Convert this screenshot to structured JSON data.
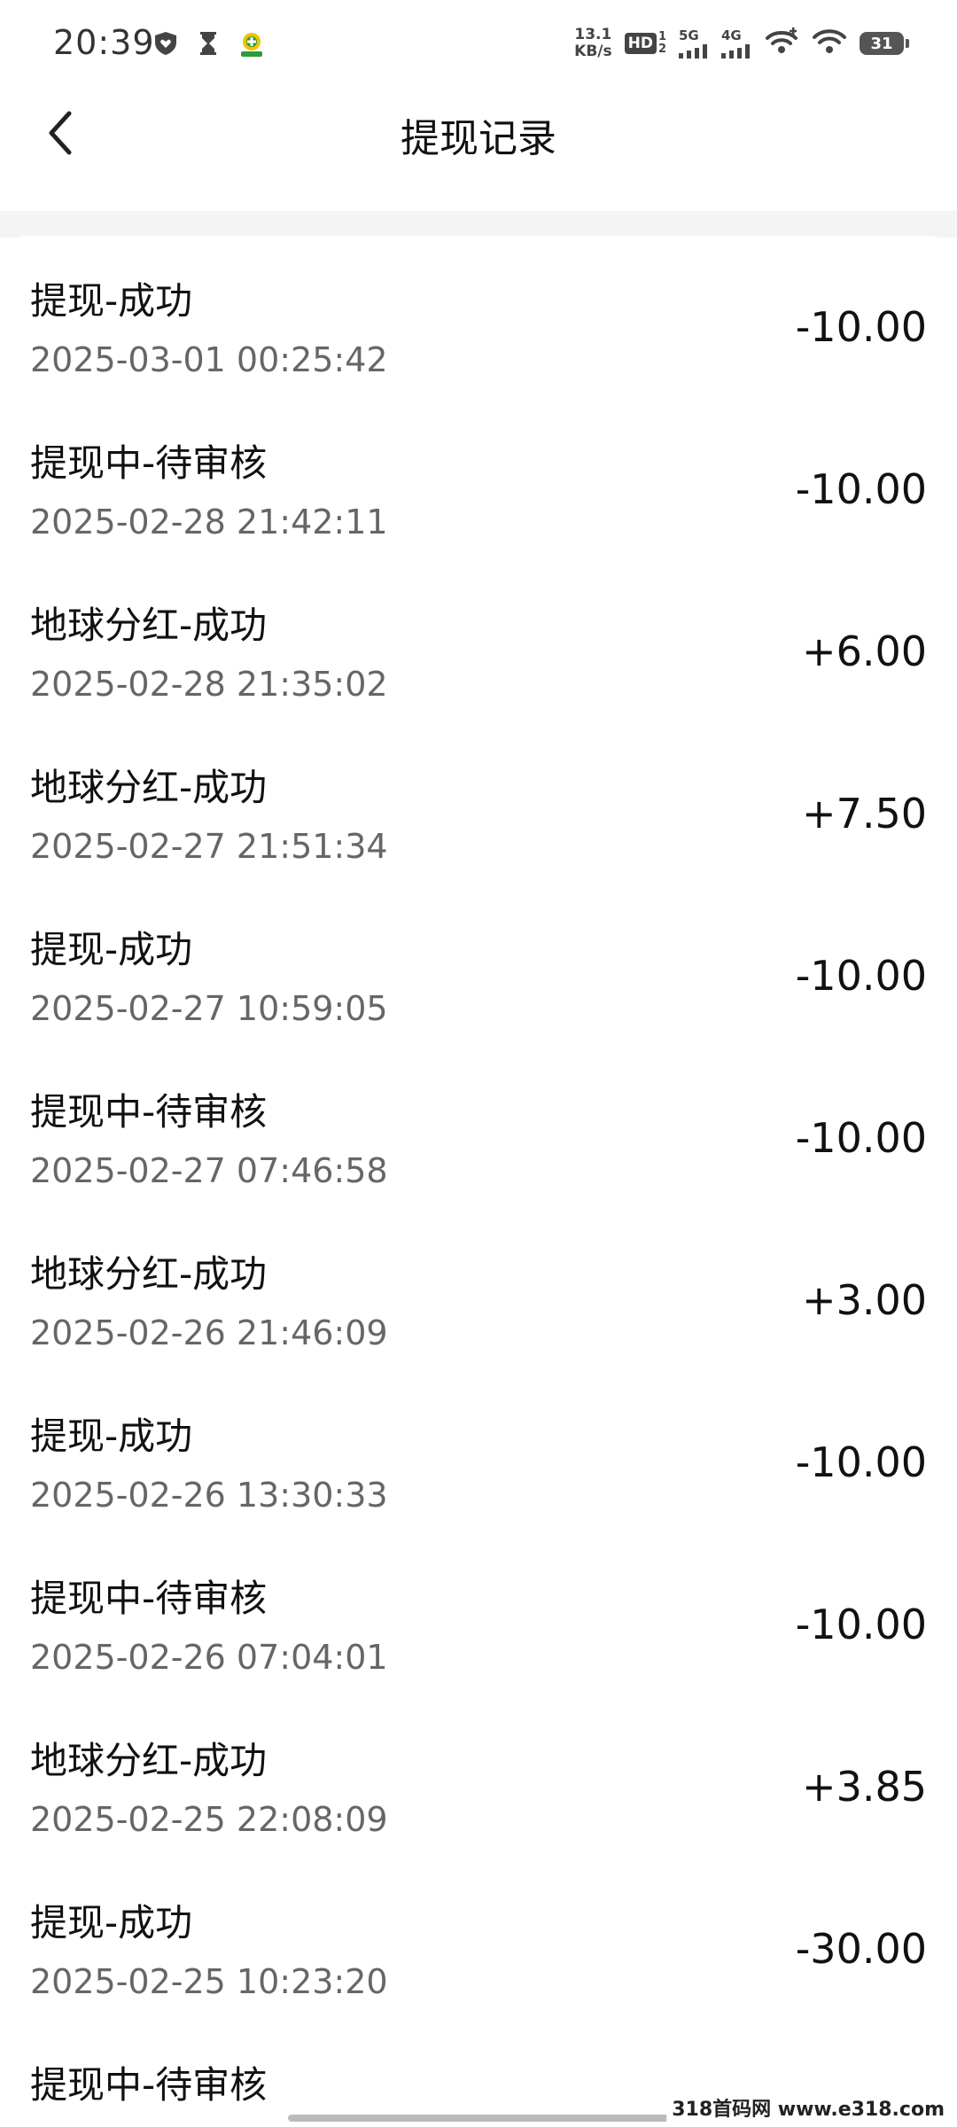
{
  "status_bar": {
    "time": "20:39",
    "net_speed_value": "13.1",
    "net_speed_unit": "KB/s",
    "hd_label": "HD",
    "hd_sub_top": "1",
    "hd_sub_bottom": "2",
    "signal1_gen": "5G",
    "signal2_gen": "4G",
    "battery": "31"
  },
  "header": {
    "title": "提现记录"
  },
  "records": [
    {
      "title": "提现-成功",
      "time": "2025-03-01 00:25:42",
      "amount": "-10.00"
    },
    {
      "title": "提现中-待审核",
      "time": "2025-02-28 21:42:11",
      "amount": "-10.00"
    },
    {
      "title": "地球分红-成功",
      "time": "2025-02-28 21:35:02",
      "amount": "+6.00"
    },
    {
      "title": "地球分红-成功",
      "time": "2025-02-27 21:51:34",
      "amount": "+7.50"
    },
    {
      "title": "提现-成功",
      "time": "2025-02-27 10:59:05",
      "amount": "-10.00"
    },
    {
      "title": "提现中-待审核",
      "time": "2025-02-27 07:46:58",
      "amount": "-10.00"
    },
    {
      "title": "地球分红-成功",
      "time": "2025-02-26 21:46:09",
      "amount": "+3.00"
    },
    {
      "title": "提现-成功",
      "time": "2025-02-26 13:30:33",
      "amount": "-10.00"
    },
    {
      "title": "提现中-待审核",
      "time": "2025-02-26 07:04:01",
      "amount": "-10.00"
    },
    {
      "title": "地球分红-成功",
      "time": "2025-02-25 22:08:09",
      "amount": "+3.85"
    },
    {
      "title": "提现-成功",
      "time": "2025-02-25 10:23:20",
      "amount": "-30.00"
    },
    {
      "title": "提现中-待审核",
      "time": "",
      "amount": ""
    }
  ],
  "watermark": "318首码网 www.e318.com"
}
